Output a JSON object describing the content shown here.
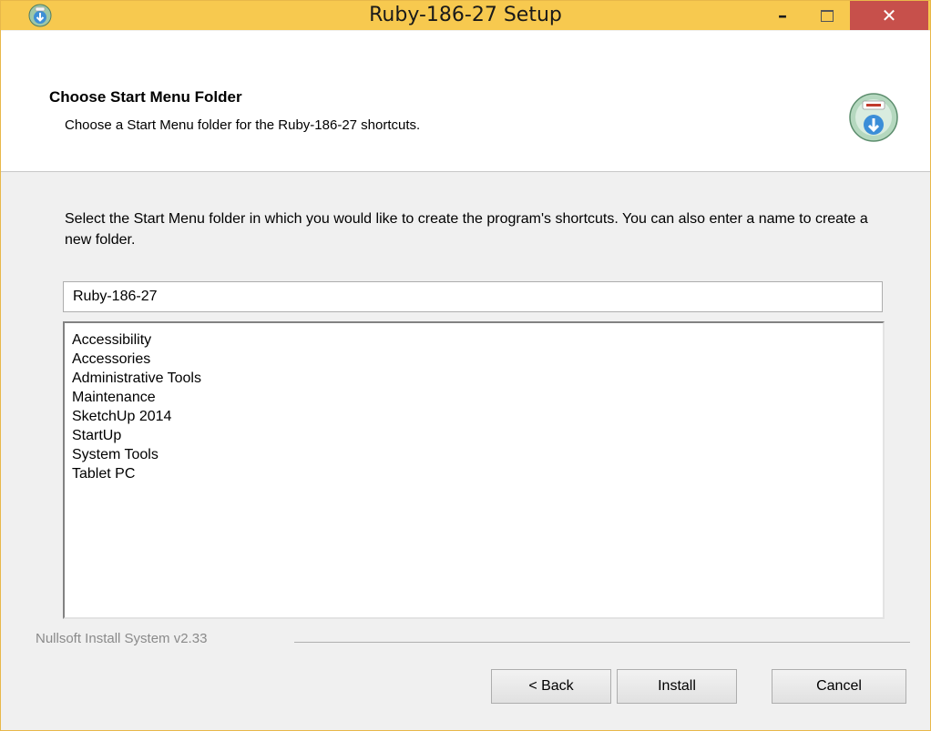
{
  "window": {
    "title": "Ruby-186-27 Setup",
    "minimize_label": "–",
    "close_label": "✕"
  },
  "header": {
    "title": "Choose Start Menu Folder",
    "subtitle": "Choose a Start Menu folder for the Ruby-186-27 shortcuts."
  },
  "body": {
    "description": "Select the Start Menu folder in which you would like to create the program's shortcuts. You can also enter a name to create a new folder.",
    "folder_input_value": "Ruby-186-27",
    "folders": [
      "Accessibility",
      "Accessories",
      "Administrative Tools",
      "Maintenance",
      "SketchUp 2014",
      "StartUp",
      "System Tools",
      "Tablet PC"
    ]
  },
  "footer": {
    "branding": "Nullsoft Install System v2.33",
    "back_label": "< Back",
    "install_label": "Install",
    "cancel_label": "Cancel"
  },
  "colors": {
    "titlebar": "#f7c94f",
    "close_button": "#c7504b"
  },
  "icons": {
    "app_icon": "installer-disc-icon",
    "header_icon": "installer-disc-download-icon"
  }
}
